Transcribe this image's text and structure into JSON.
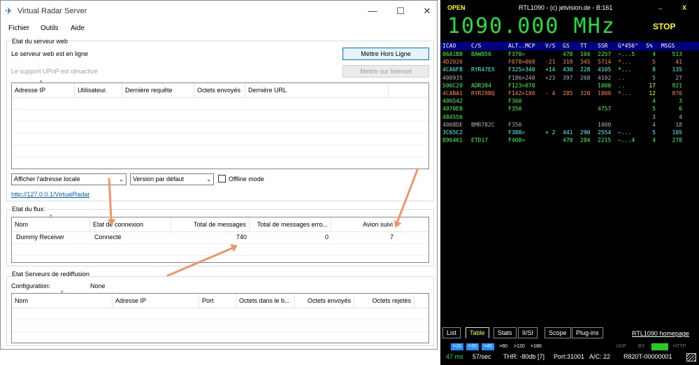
{
  "vrs": {
    "title": "Virtual Radar Server",
    "win_minimize": "—",
    "win_maximize": "☐",
    "win_close": "✕",
    "menu": [
      "Fichier",
      "Outils",
      "Aide"
    ],
    "web": {
      "group_label": "Etat du serveur web",
      "status": "Le serveur web est en ligne",
      "upnp": "Le support UPnP est désactivé",
      "btn_offline": "Mettre Hors Ligne",
      "btn_internet": "Mettre sur Internet",
      "columns": [
        "Adresse IP",
        "Utilisateur.",
        "Dernière requête",
        "Octets envoyés",
        "Dernière URL"
      ],
      "address_combo": "Afficher l'adresse locale",
      "version_combo": "Version par défaut",
      "offline_mode": "Offline mode",
      "url": "http://127.0.0.1/VirtualRadar"
    },
    "flux": {
      "group_label": "Etat du flux:",
      "columns": [
        "Nom",
        "Etat de connexion",
        "Total de messages",
        "Total de messages erro...",
        "Avion suivi"
      ],
      "row": [
        "Dummy Receiver",
        "Connecté",
        "740",
        "0",
        "7"
      ]
    },
    "rebroadcast": {
      "group_label": "Etat Serveurs de rediffusion",
      "config_label": "Configuration:",
      "config_value": "None",
      "columns": [
        "Nom",
        "Adresse IP",
        "Port",
        "Octets dans le b...",
        "Octets envoyés",
        "Octets rejetés"
      ]
    }
  },
  "rtl": {
    "open": "OPEN",
    "title": "RTL1090 - (c) jetvision.de - B:161",
    "min": "_",
    "close": "X",
    "freq": "1090.000 MHz",
    "stop": "STOP",
    "columns": [
      "ICAO",
      "C/S",
      "ALT..MCP",
      "V/S",
      "GS",
      "TT",
      "SSR",
      "G*456^",
      "S%",
      "MSGS"
    ],
    "rows": [
      {
        "color": "#33ff33",
        "cells": [
          "06A1B8",
          "BAW856",
          "F370=",
          "",
          "478",
          "104",
          "2257",
          "~...5",
          "4",
          "513"
        ]
      },
      {
        "color": "#ff8833",
        "cells": [
          "4D2026",
          "",
          "F078>060",
          "-21",
          "319",
          "345",
          "5714",
          "*...",
          "5",
          "41"
        ]
      },
      {
        "color": "#33ffff",
        "cells": [
          "4CA6FB",
          "RYR47EX",
          "F325>340",
          "+14",
          "430",
          "228",
          "4105",
          "*...",
          "8",
          "135"
        ]
      },
      {
        "color": "#b0b0b0",
        "cells": [
          "400935",
          "",
          "F186>240",
          "+23",
          "397",
          "268",
          "4102",
          "..",
          "5",
          "27"
        ]
      },
      {
        "color": "#33ff33",
        "cells": [
          "506C29",
          "ADR394",
          "F123>070",
          "",
          "",
          "",
          "1000",
          "..",
          "17",
          "921"
        ]
      },
      {
        "color": "#ff8833",
        "cells": [
          "4CABA1",
          "RYR29BQ",
          "F142>100",
          "- 4",
          "285",
          "320",
          "1000",
          "*...",
          "12",
          "876"
        ]
      },
      {
        "color": "#33ff33",
        "cells": [
          "406542",
          "",
          "F360",
          "",
          "",
          "",
          "",
          "",
          "4",
          "3"
        ]
      },
      {
        "color": "#33ff33",
        "cells": [
          "4070EB",
          "",
          "F350",
          "",
          "",
          "",
          "4757",
          "",
          "5",
          "6"
        ]
      },
      {
        "color": "#33ff33",
        "cells": [
          "484556",
          "",
          "",
          "",
          "",
          "",
          "",
          "",
          "3",
          "4"
        ]
      },
      {
        "color": "#b0b0b0",
        "cells": [
          "4008DE",
          "BMR782C",
          "F350",
          "",
          "",
          "",
          "1000",
          "",
          "4",
          "18"
        ]
      },
      {
        "color": "#33ffff",
        "cells": [
          "3C65C2",
          "",
          "F380=",
          "+ 2",
          "441",
          "290",
          "2554",
          "~...",
          "5",
          "105"
        ]
      },
      {
        "color": "#33ff33",
        "cells": [
          "896461",
          "ETD17",
          "F400=",
          "",
          "470",
          "284",
          "2215",
          "~...4",
          "4",
          "278"
        ]
      }
    ],
    "tabs": [
      "List",
      "Table",
      "Stats",
      "II/SI",
      "Scope",
      "Plug-ins"
    ],
    "homepage": "RTL1090 homepage",
    "ranges": [
      ">10",
      ">20",
      ">40",
      ">80",
      ">120",
      ">180"
    ],
    "proto": [
      "UDP",
      "BS",
      "",
      "HTTP"
    ],
    "status": {
      "ms": "47 ms",
      "rate": "57/sec",
      "thr": "THR: -80db [7]",
      "port": "Port:31001",
      "ac": "A/C: 22",
      "id": "R820T-00000001"
    },
    "colors": {
      "green": "#20e040",
      "yellow": "#ffff00",
      "header": "#000080",
      "chip": "#1e90ff"
    }
  }
}
